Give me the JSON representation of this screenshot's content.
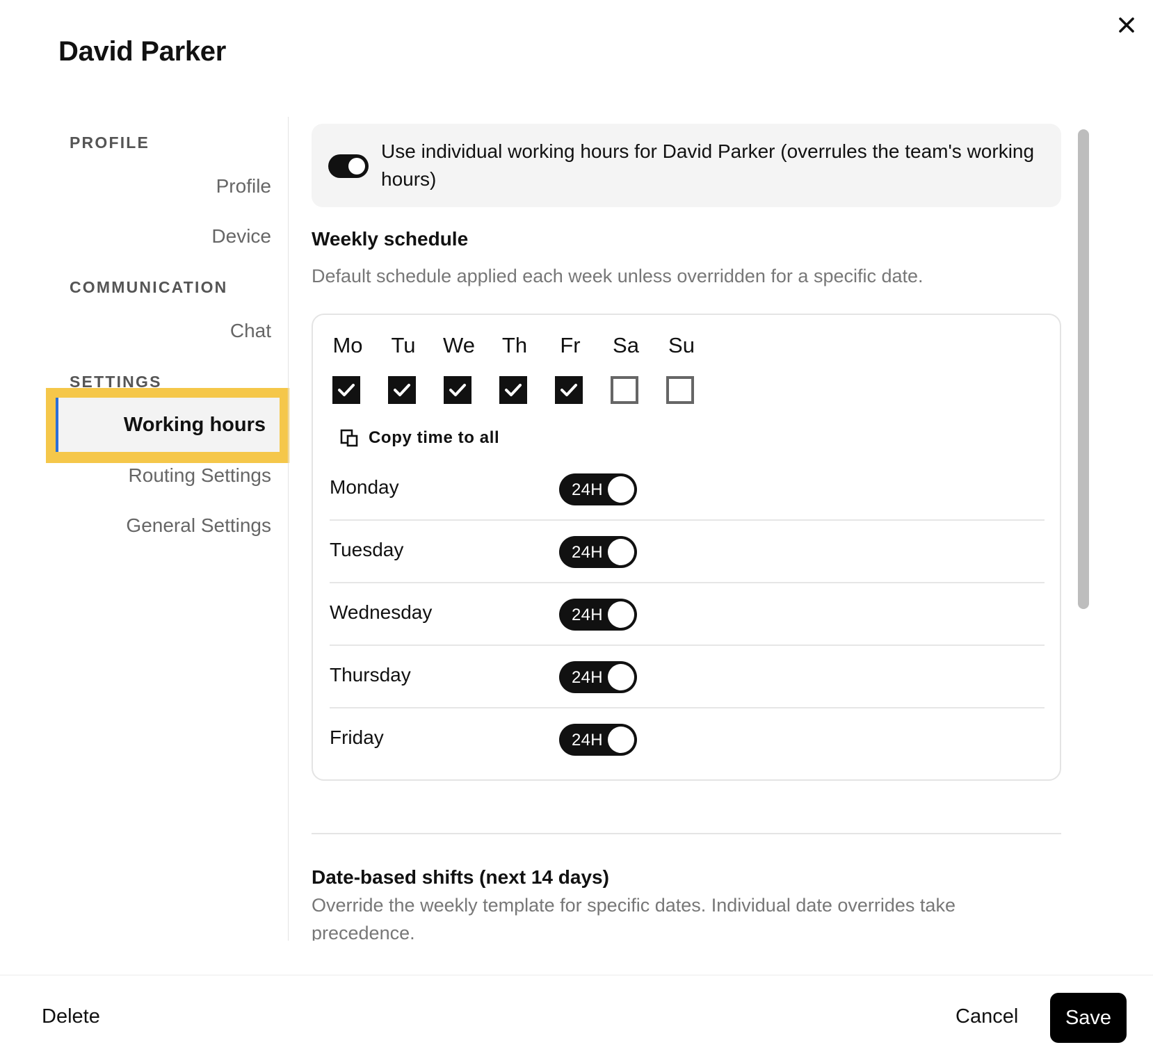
{
  "header": {
    "title": "David Parker"
  },
  "sidebar": {
    "sections": [
      {
        "label": "PROFILE",
        "items": [
          "Profile",
          "Device"
        ]
      },
      {
        "label": "COMMUNICATION",
        "items": [
          "Chat"
        ]
      },
      {
        "label": "SETTINGS",
        "items": [
          "Working hours",
          "Routing Settings",
          "General Settings"
        ]
      }
    ],
    "active_item": "Working hours"
  },
  "banner": {
    "toggle_on": true,
    "text": "Use individual working hours for David Parker (overrules the team's working hours)"
  },
  "weekly": {
    "title": "Weekly schedule",
    "subtitle": "Default schedule applied each week unless overridden for a specific date.",
    "days": [
      {
        "abbr": "Mo",
        "checked": true
      },
      {
        "abbr": "Tu",
        "checked": true
      },
      {
        "abbr": "We",
        "checked": true
      },
      {
        "abbr": "Th",
        "checked": true
      },
      {
        "abbr": "Fr",
        "checked": true
      },
      {
        "abbr": "Sa",
        "checked": false
      },
      {
        "abbr": "Su",
        "checked": false
      }
    ],
    "copy_label": "Copy time to all",
    "rows": [
      {
        "day": "Monday",
        "toggle": "24H"
      },
      {
        "day": "Tuesday",
        "toggle": "24H"
      },
      {
        "day": "Wednesday",
        "toggle": "24H"
      },
      {
        "day": "Thursday",
        "toggle": "24H"
      },
      {
        "day": "Friday",
        "toggle": "24H"
      }
    ]
  },
  "shifts": {
    "title": "Date-based shifts (next 14 days)",
    "subtitle": "Override the weekly template for specific dates. Individual date overrides take precedence."
  },
  "footer": {
    "delete_label": "Delete",
    "cancel_label": "Cancel",
    "save_label": "Save"
  }
}
